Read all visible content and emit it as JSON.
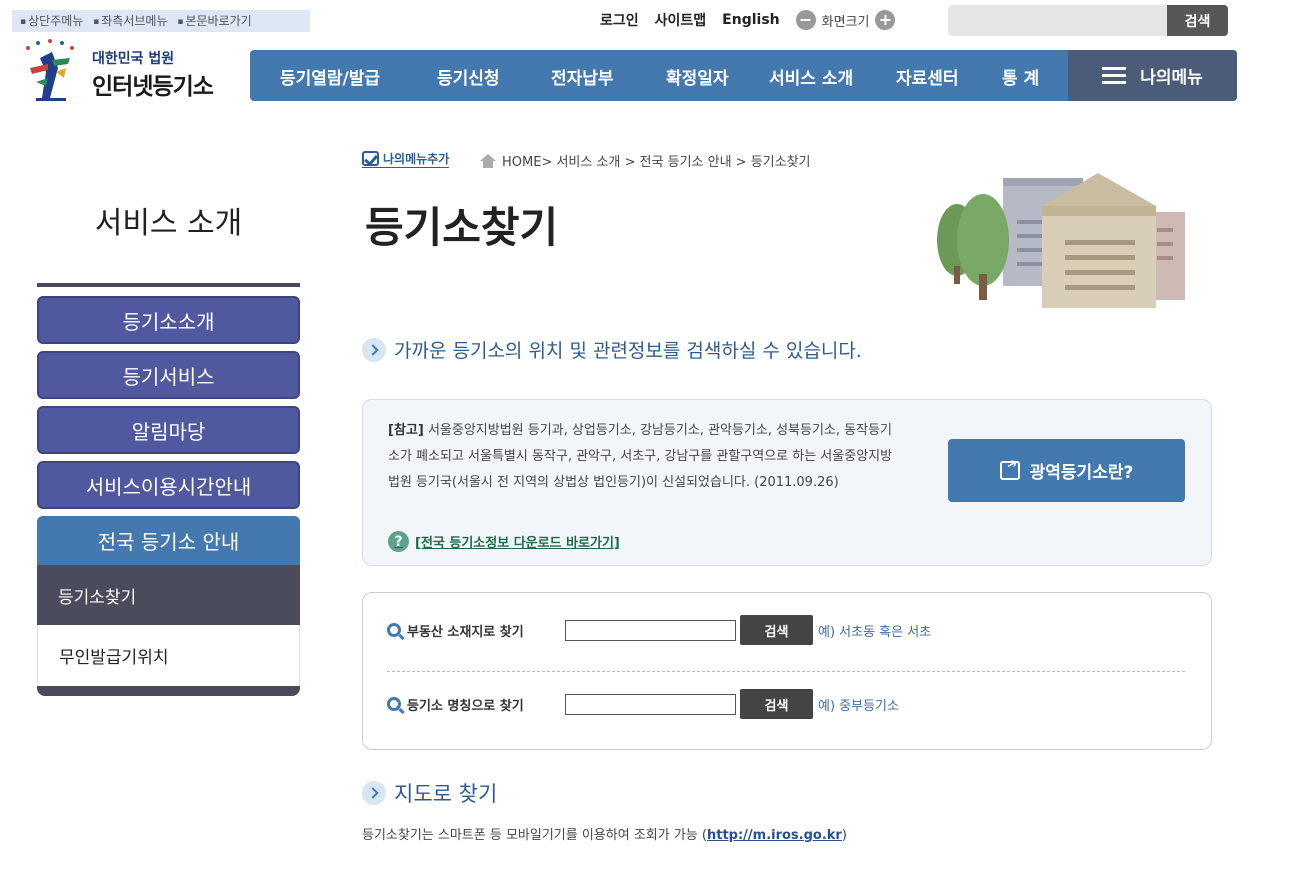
{
  "skip_links": [
    "상단주메뉴",
    "좌측서브메뉴",
    "본문바로가기"
  ],
  "util": {
    "login": "로그인",
    "sitemap": "사이트맵",
    "english": "English",
    "zoom_label": "화면크기",
    "search_button": "검색",
    "search_placeholder": ""
  },
  "logo": {
    "line1": "대한민국 법원",
    "line2": "인터넷등기소"
  },
  "gnb": [
    "등기열람/발급",
    "등기신청",
    "전자납부",
    "확정일자",
    "서비스 소개",
    "자료센터",
    "통 계"
  ],
  "my_menu": "나의메뉴",
  "lnb": {
    "title": "서비스 소개",
    "items": [
      "등기소소개",
      "등기서비스",
      "알림마당",
      "서비스이용시간안내"
    ],
    "active": "전국 등기소 안내",
    "sub_active": "등기소찾기",
    "sub_other": "무인발급기위치"
  },
  "breadcrumb": {
    "add_menu": "나의메뉴추가",
    "path": "HOME> 서비스 소개 > 전국 등기소 안내 > 등기소찾기"
  },
  "page_title": "등기소찾기",
  "intro": "가까운 등기소의 위치 및 관련정보를 검색하실 수 있습니다.",
  "notice": {
    "tag": "[참고]",
    "text": " 서울중앙지방법원 등기과, 상업등기소, 강남등기소, 관악등기소, 성북등기소, 동작등기소가 폐소되고 서울특별시 동작구, 관악구, 서초구, 강남구를 관할구역으로 하는 서울중앙지방법원 등기국(서울시 전 지역의 상법상 법인등기)이 신설되었습니다. (2011.09.26)",
    "download": "[전국 등기소정보 다운로드 바로가기]",
    "wide_button": "광역등기소란?"
  },
  "search": {
    "row1_label": "부동산 소재지로 찾기",
    "row1_example": "예) 서초동 혹은 서초",
    "row2_label": "등기소 명칭으로 찾기",
    "row2_example": "예) 중부등기소",
    "button": "검색"
  },
  "map_heading": "지도로 찾기",
  "footer": {
    "text": "등기소찾기는 스마트폰 등 모바일기기를 이용하여 조회가 가능 (",
    "link": "http://m.iros.go.kr",
    "close": ")"
  }
}
